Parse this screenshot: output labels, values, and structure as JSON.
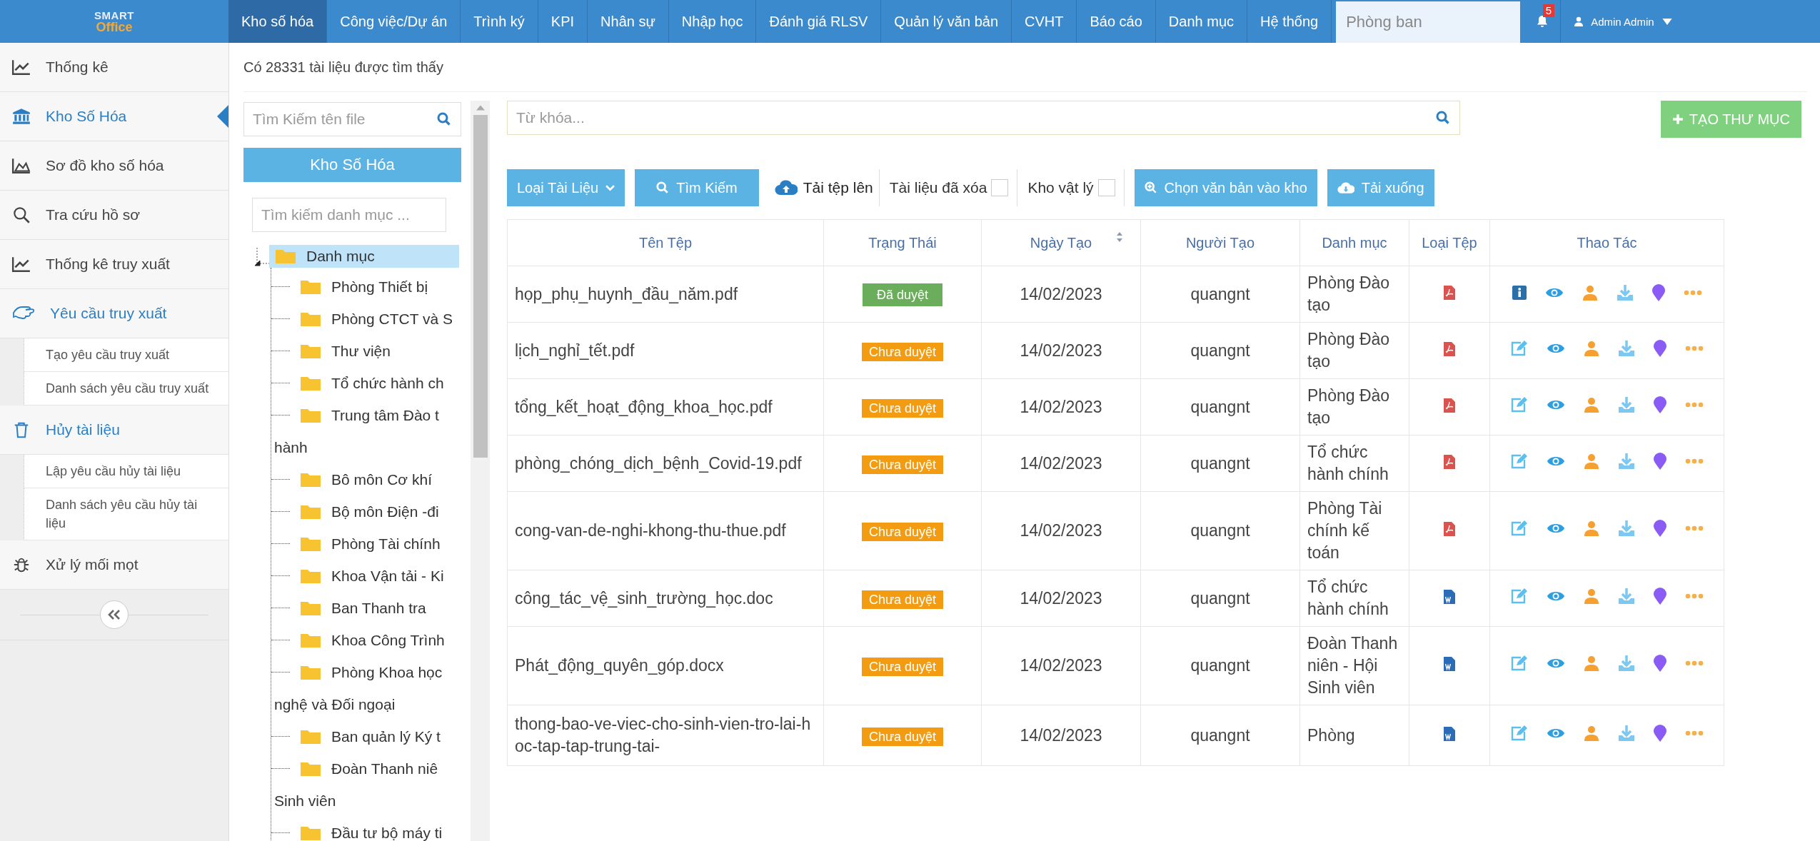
{
  "logo": {
    "line1": "SMART",
    "line2": "Office"
  },
  "nav": {
    "items": [
      {
        "label": "Kho số hóa",
        "selected": true
      },
      {
        "label": "Công việc/Dự án",
        "selected": false
      },
      {
        "label": "Trình ký",
        "selected": false
      },
      {
        "label": "KPI",
        "selected": false
      },
      {
        "label": "Nhân sự",
        "selected": false
      },
      {
        "label": "Nhập học",
        "selected": false
      },
      {
        "label": "Đánh giá RLSV",
        "selected": false
      },
      {
        "label": "Quản lý văn bản",
        "selected": false
      },
      {
        "label": "CVHT",
        "selected": false
      },
      {
        "label": "Báo cáo",
        "selected": false
      },
      {
        "label": "Danh mục",
        "selected": false
      },
      {
        "label": "Hệ thống",
        "selected": false
      }
    ],
    "department_field": {
      "placeholder": "Phòng ban"
    },
    "notification_count": "5",
    "user": "Admin Admin"
  },
  "sidebar": {
    "items": [
      {
        "label": "Thống kê",
        "selected": false
      },
      {
        "label": "Kho Số Hóa",
        "selected": true
      },
      {
        "label": "Sơ đồ kho số hóa",
        "selected": false
      },
      {
        "label": "Tra cứu hồ sơ",
        "selected": false
      },
      {
        "label": "Thống kê truy xuất",
        "selected": false
      },
      {
        "label": "Yêu cầu truy xuất",
        "selected": false,
        "expanded": true,
        "children": [
          {
            "label": "Tạo yêu cầu truy xuất"
          },
          {
            "label": "Danh sách yêu cầu truy xuất"
          }
        ]
      },
      {
        "label": "Hủy tài liệu",
        "selected": false,
        "expanded": true,
        "children": [
          {
            "label": "Lập yêu cầu hủy tài liệu"
          },
          {
            "label": "Danh sách yêu cầu hủy tài liệu"
          }
        ]
      },
      {
        "label": "Xử lý mối mọt",
        "selected": false
      }
    ]
  },
  "result_count": "Có 28331 tài liệu được tìm thấy",
  "tree_panel": {
    "file_search": {
      "placeholder": "Tìm Kiếm tên file"
    },
    "root_button": "Kho Số Hóa",
    "category_search": {
      "placeholder": "Tìm kiếm danh mục ..."
    },
    "tree": {
      "lines": [
        "Danh mục"
      ],
      "selected": true,
      "expanded": true,
      "children": [
        {
          "lines": [
            "Phòng Thiết bị"
          ],
          "selected": false
        },
        {
          "lines": [
            "Phòng CTCT và S"
          ],
          "selected": false
        },
        {
          "lines": [
            "Thư viện"
          ],
          "selected": false
        },
        {
          "lines": [
            "Tổ chức hành ch"
          ],
          "selected": false
        },
        {
          "lines": [
            "Trung tâm Đào t",
            "hành"
          ],
          "selected": false
        },
        {
          "lines": [
            "Bô môn Cơ khí"
          ],
          "selected": false
        },
        {
          "lines": [
            "Bộ môn Điện -đi"
          ],
          "selected": false
        },
        {
          "lines": [
            "Phòng Tài chính"
          ],
          "selected": false
        },
        {
          "lines": [
            "Khoa Vận tải - Ki"
          ],
          "selected": false
        },
        {
          "lines": [
            "Ban Thanh tra"
          ],
          "selected": false
        },
        {
          "lines": [
            "Khoa Công Trình"
          ],
          "selected": false
        },
        {
          "lines": [
            "Phòng Khoa học",
            "nghệ và Đối ngoại"
          ],
          "selected": false
        },
        {
          "lines": [
            "Ban quản lý Ký t"
          ],
          "selected": false
        },
        {
          "lines": [
            "Đoàn Thanh niê",
            "Sinh viên"
          ],
          "selected": false
        },
        {
          "lines": [
            "Đầu tư bộ máy ti"
          ],
          "selected": false
        }
      ]
    }
  },
  "keyword_field": {
    "placeholder": "Từ khóa..."
  },
  "create_folder_button": "TẠO THƯ MỤC",
  "toolbar": {
    "type_dropdown": "Loại Tài Liệu",
    "search_button": "Tìm Kiếm",
    "upload_link": "Tải tệp lên",
    "deleted_filter": {
      "label": "Tài liệu đã xóa",
      "checked": false
    },
    "physical_filter": {
      "label": "Kho vật lý",
      "checked": false
    },
    "select_button": "Chọn văn bản vào kho",
    "download_button": "Tải xuống"
  },
  "table": {
    "columns": [
      "Tên Tệp",
      "Trạng Thái",
      "Ngày Tạo",
      "Người Tạo",
      "Danh mục",
      "Loại Tệp",
      "Thao Tác"
    ],
    "rows": [
      {
        "name": "họp_phụ_huynh_đầu_năm.pdf",
        "status": {
          "text": "Đã duyệt",
          "kind": "approved"
        },
        "date": "14/02/2023",
        "creator": "quangnt",
        "category": "Phòng Đào tạo",
        "file_icon": {
          "kind": "pdf"
        },
        "actions": [
          {
            "kind": "info"
          },
          {
            "kind": "view"
          },
          {
            "kind": "user"
          },
          {
            "kind": "download"
          },
          {
            "kind": "marker"
          },
          {
            "kind": "more"
          }
        ]
      },
      {
        "name": "lịch_nghỉ_tết.pdf",
        "status": {
          "text": "Chưa duyệt",
          "kind": "pending"
        },
        "date": "14/02/2023",
        "creator": "quangnt",
        "category": "Phòng Đào tạo",
        "file_icon": {
          "kind": "pdf"
        },
        "actions": [
          {
            "kind": "edit"
          },
          {
            "kind": "view"
          },
          {
            "kind": "user"
          },
          {
            "kind": "download"
          },
          {
            "kind": "marker"
          },
          {
            "kind": "more"
          }
        ]
      },
      {
        "name": "tổng_kết_hoạt_động_khoa_học.pdf",
        "status": {
          "text": "Chưa duyệt",
          "kind": "pending"
        },
        "date": "14/02/2023",
        "creator": "quangnt",
        "category": "Phòng Đào tạo",
        "file_icon": {
          "kind": "pdf"
        },
        "actions": [
          {
            "kind": "edit"
          },
          {
            "kind": "view"
          },
          {
            "kind": "user"
          },
          {
            "kind": "download"
          },
          {
            "kind": "marker"
          },
          {
            "kind": "more"
          }
        ]
      },
      {
        "name": "phòng_chóng_dịch_bệnh_Covid-19.pdf",
        "status": {
          "text": "Chưa duyệt",
          "kind": "pending"
        },
        "date": "14/02/2023",
        "creator": "quangnt",
        "category": "Tổ chức hành chính",
        "file_icon": {
          "kind": "pdf"
        },
        "actions": [
          {
            "kind": "edit"
          },
          {
            "kind": "view"
          },
          {
            "kind": "user"
          },
          {
            "kind": "download"
          },
          {
            "kind": "marker"
          },
          {
            "kind": "more"
          }
        ]
      },
      {
        "name": "cong-van-de-nghi-khong-thu-thue.pdf",
        "status": {
          "text": "Chưa duyệt",
          "kind": "pending"
        },
        "date": "14/02/2023",
        "creator": "quangnt",
        "category": "Phòng Tài chính kế toán",
        "file_icon": {
          "kind": "pdf"
        },
        "actions": [
          {
            "kind": "edit"
          },
          {
            "kind": "view"
          },
          {
            "kind": "user"
          },
          {
            "kind": "download"
          },
          {
            "kind": "marker"
          },
          {
            "kind": "more"
          }
        ]
      },
      {
        "name": "công_tác_vệ_sinh_trường_học.doc",
        "status": {
          "text": "Chưa duyệt",
          "kind": "pending"
        },
        "date": "14/02/2023",
        "creator": "quangnt",
        "category": "Tổ chức hành chính",
        "file_icon": {
          "kind": "word"
        },
        "actions": [
          {
            "kind": "edit"
          },
          {
            "kind": "view"
          },
          {
            "kind": "user"
          },
          {
            "kind": "download"
          },
          {
            "kind": "marker"
          },
          {
            "kind": "more"
          }
        ]
      },
      {
        "name": "Phát_động_quyên_góp.docx",
        "status": {
          "text": "Chưa duyệt",
          "kind": "pending"
        },
        "date": "14/02/2023",
        "creator": "quangnt",
        "category": "Đoàn Thanh niên - Hội Sinh viên",
        "file_icon": {
          "kind": "word"
        },
        "actions": [
          {
            "kind": "edit"
          },
          {
            "kind": "view"
          },
          {
            "kind": "user"
          },
          {
            "kind": "download"
          },
          {
            "kind": "marker"
          },
          {
            "kind": "more"
          }
        ]
      },
      {
        "name": "thong-bao-ve-viec-cho-sinh-vien-tro-lai-hoc-tap-tap-trung-tai-",
        "status": {
          "text": "Chưa duyệt",
          "kind": "pending"
        },
        "date": "14/02/2023",
        "creator": "quangnt",
        "category": "Phòng",
        "file_icon": {
          "kind": "word"
        },
        "actions": [
          {
            "kind": "edit"
          },
          {
            "kind": "view"
          },
          {
            "kind": "user"
          },
          {
            "kind": "download"
          },
          {
            "kind": "marker"
          },
          {
            "kind": "more"
          }
        ]
      }
    ]
  }
}
